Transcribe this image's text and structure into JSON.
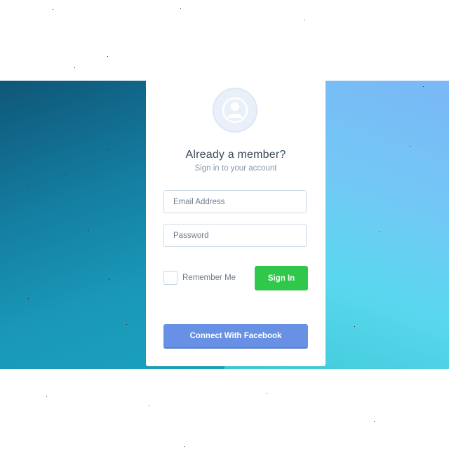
{
  "login": {
    "title": "Already a member?",
    "subtitle": "Sign in to your account",
    "email_placeholder": "Email Address",
    "email_value": "",
    "password_placeholder": "Password",
    "password_value": "",
    "remember_label": "Remember Me",
    "remember_checked": false,
    "signin_label": "Sign In",
    "facebook_label": "Connect With Facebook"
  },
  "icons": {
    "avatar": "user-avatar-icon",
    "checkbox": "checkbox-icon"
  },
  "colors": {
    "background": "#ffffff",
    "card": "#ffffff",
    "signin_button": "#30c84a",
    "facebook_button": "#6891e5",
    "avatar_circle": "#e9f0fa",
    "band_left": "#147fa2",
    "band_right": "#73c7f5"
  }
}
